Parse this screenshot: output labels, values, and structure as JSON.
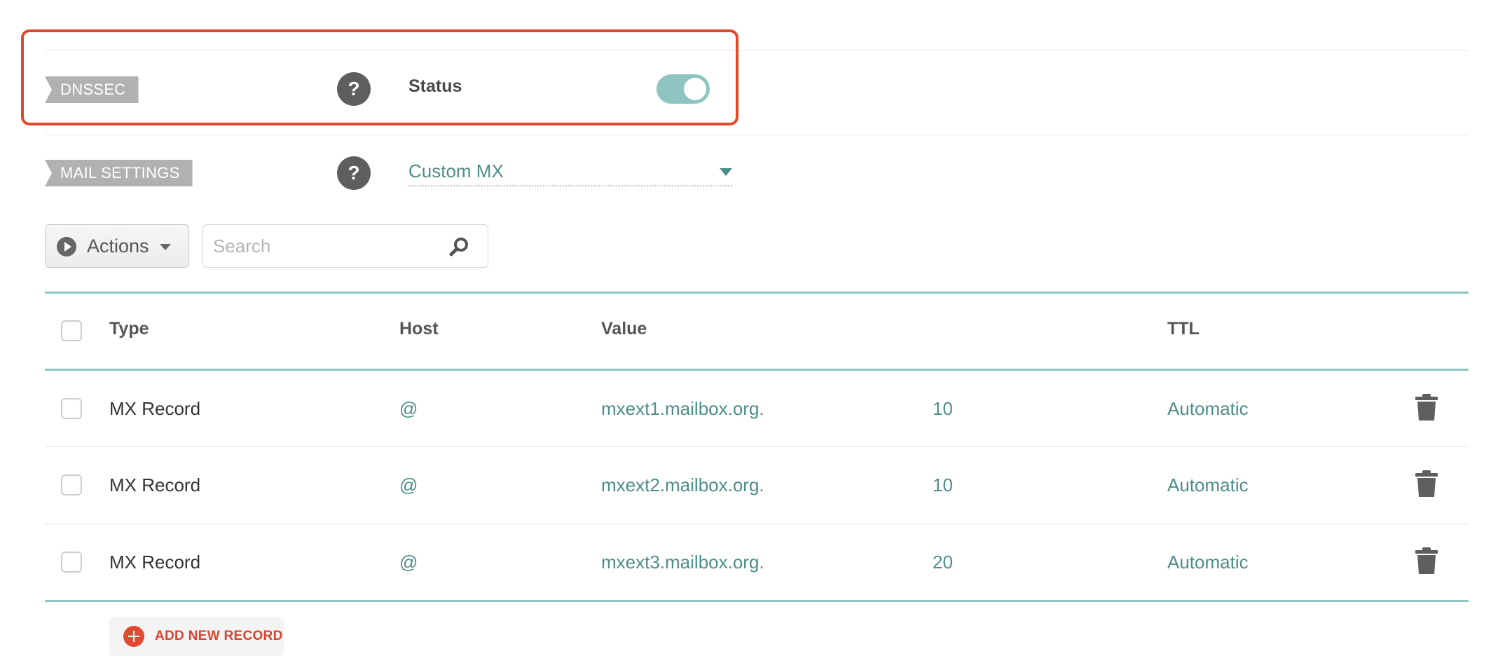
{
  "dnssec": {
    "tag": "DNSSEC",
    "help_glyph": "?",
    "status_label": "Status",
    "toggle_on": true
  },
  "mail_settings": {
    "tag": "MAIL SETTINGS",
    "help_glyph": "?",
    "selected": "Custom MX"
  },
  "toolbar": {
    "actions_label": "Actions",
    "search_placeholder": "Search"
  },
  "table": {
    "headers": {
      "type": "Type",
      "host": "Host",
      "value": "Value",
      "ttl": "TTL"
    },
    "rows": [
      {
        "type": "MX Record",
        "host": "@",
        "value": "mxext1.mailbox.org.",
        "priority": "10",
        "ttl": "Automatic"
      },
      {
        "type": "MX Record",
        "host": "@",
        "value": "mxext2.mailbox.org.",
        "priority": "10",
        "ttl": "Automatic"
      },
      {
        "type": "MX Record",
        "host": "@",
        "value": "mxext3.mailbox.org.",
        "priority": "20",
        "ttl": "Automatic"
      }
    ]
  },
  "add_record_label": "ADD NEW RECORD",
  "colors": {
    "accent_teal": "#4d8e89",
    "toggle_on": "#8fc4c1",
    "highlight": "#e5472b",
    "add_red": "#d9442f"
  },
  "icons": {
    "help": "question-circle-icon",
    "actions": "play-circle-icon",
    "search": "magnifier-icon",
    "delete": "trash-icon",
    "add": "plus-circle-icon",
    "dropdown": "caret-down-icon"
  }
}
